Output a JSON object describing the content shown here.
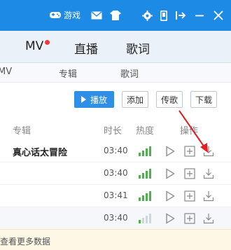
{
  "titlebar": {
    "game_label": "游戏",
    "icons": [
      "gamepad-icon",
      "mail-icon",
      "shirt-icon",
      "gear-icon",
      "phone-icon",
      "mini-mode-icon",
      "minimize-icon",
      "close-icon"
    ],
    "accent": "#1d8ae6"
  },
  "main_tabs": {
    "mv": "MV",
    "live": "直播",
    "lyrics": "歌词",
    "mv_notification_color": "#f03c3c"
  },
  "sub_tabs": {
    "mv": "MV",
    "album": "专辑",
    "lyrics": "歌词"
  },
  "toolbar": {
    "play": "播放",
    "add": "添加",
    "upload": "传歌",
    "download": "下载"
  },
  "table": {
    "headers": {
      "album": "专辑",
      "duration": "时长",
      "heat": "热度",
      "ops": "操作"
    },
    "rows": [
      {
        "album": "真心话太冒险",
        "duration": "03:40",
        "heat_level": 4
      },
      {
        "album": "",
        "duration": "03:40",
        "heat_level": 4
      },
      {
        "album": "",
        "duration": "03:41",
        "heat_level": 4
      },
      {
        "album": "",
        "duration": "03:40",
        "heat_level": 1
      }
    ]
  },
  "footer": {
    "text": "查看更多数据"
  },
  "annotation": {
    "color": "#e02020"
  }
}
